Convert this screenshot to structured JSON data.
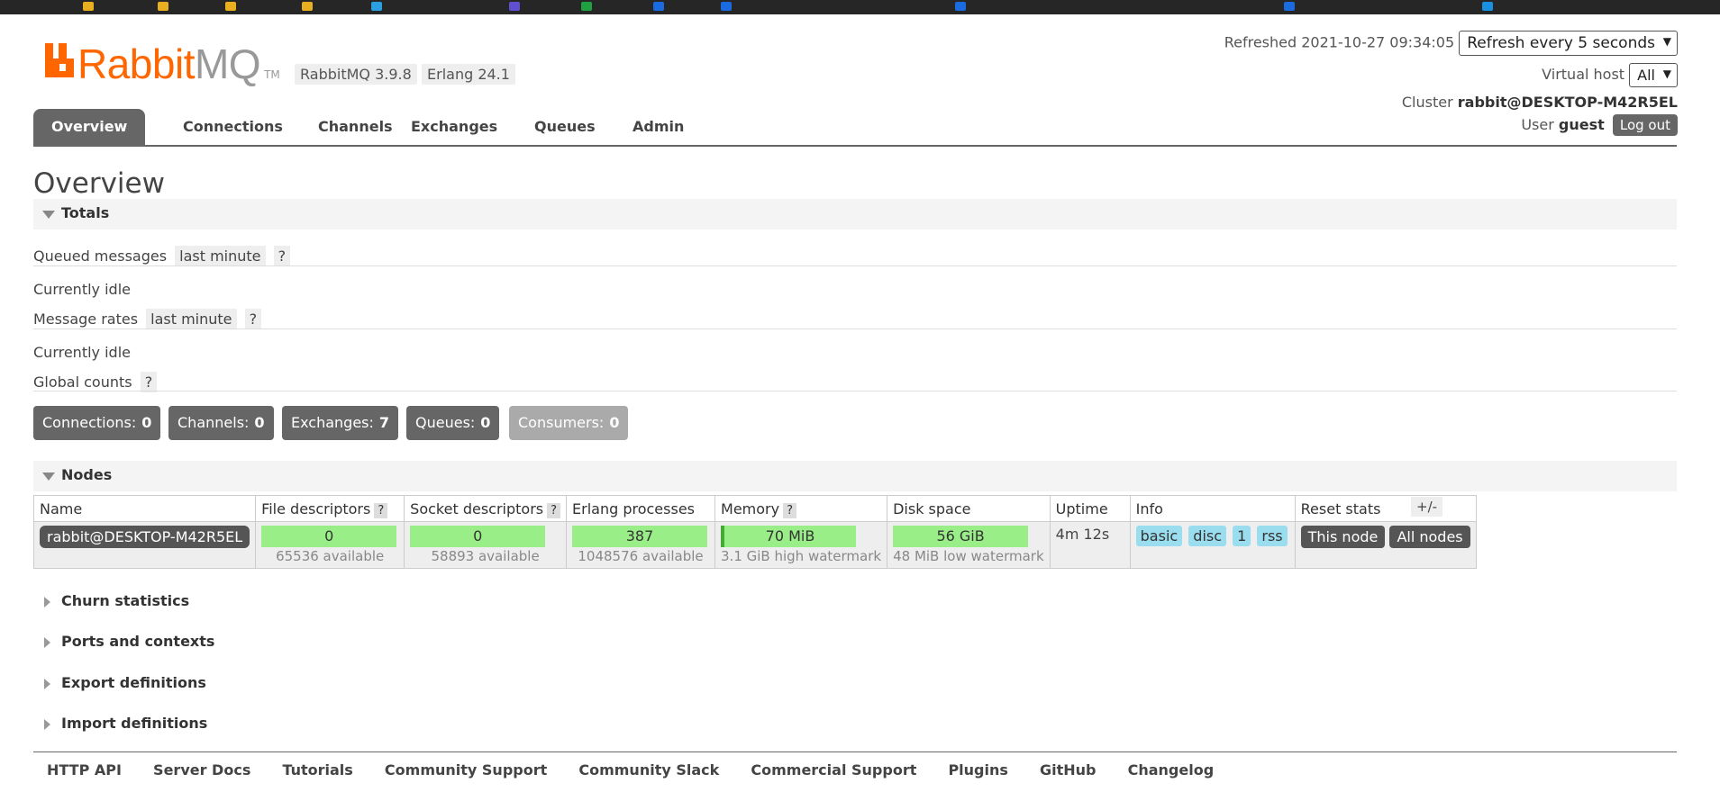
{
  "brand": {
    "rabbit": "Rabbit",
    "mq": "MQ",
    "tm": "TM"
  },
  "versions": {
    "rabbitmq": "RabbitMQ 3.9.8",
    "erlang": "Erlang 24.1"
  },
  "header": {
    "refreshed_label": "Refreshed 2021-10-27 09:34:05",
    "refresh_select": "Refresh every 5 seconds",
    "vhost_label": "Virtual host",
    "vhost_select": "All",
    "cluster_label": "Cluster",
    "cluster_name": "rabbit@DESKTOP-M42R5EL",
    "user_label": "User",
    "user_name": "guest",
    "logout": "Log out"
  },
  "tabs": [
    "Overview",
    "Connections",
    "Channels",
    "Exchanges",
    "Queues",
    "Admin"
  ],
  "page_title": "Overview",
  "totals": {
    "title": "Totals",
    "queued_label": "Queued messages",
    "queued_range": "last minute",
    "help": "?",
    "idle1": "Currently idle",
    "rates_label": "Message rates",
    "rates_range": "last minute",
    "idle2": "Currently idle",
    "global_label": "Global counts",
    "counts": [
      {
        "label": "Connections:",
        "value": "0"
      },
      {
        "label": "Channels:",
        "value": "0"
      },
      {
        "label": "Exchanges:",
        "value": "7"
      },
      {
        "label": "Queues:",
        "value": "0"
      },
      {
        "label": "Consumers:",
        "value": "0"
      }
    ]
  },
  "nodes": {
    "title": "Nodes",
    "headers": [
      "Name",
      "File descriptors",
      "Socket descriptors",
      "Erlang processes",
      "Memory",
      "Disk space",
      "Uptime",
      "Info",
      "Reset stats"
    ],
    "row": {
      "name": "rabbit@DESKTOP-M42R5EL",
      "fd": "0",
      "fd_sub": "65536 available",
      "sd": "0",
      "sd_sub": "58893 available",
      "ep": "387",
      "ep_sub": "1048576 available",
      "mem": "70 MiB",
      "mem_sub": "3.1 GiB high watermark",
      "disk": "56 GiB",
      "disk_sub": "48 MiB low watermark",
      "uptime": "4m 12s",
      "info": [
        "basic",
        "disc",
        "1",
        "rss"
      ],
      "reset_this": "This node",
      "reset_all": "All nodes"
    },
    "plus_minus": "+/-"
  },
  "collapsed": [
    "Churn statistics",
    "Ports and contexts",
    "Export definitions",
    "Import definitions"
  ],
  "footer": [
    "HTTP API",
    "Server Docs",
    "Tutorials",
    "Community Support",
    "Community Slack",
    "Commercial Support",
    "Plugins",
    "GitHub",
    "Changelog"
  ]
}
